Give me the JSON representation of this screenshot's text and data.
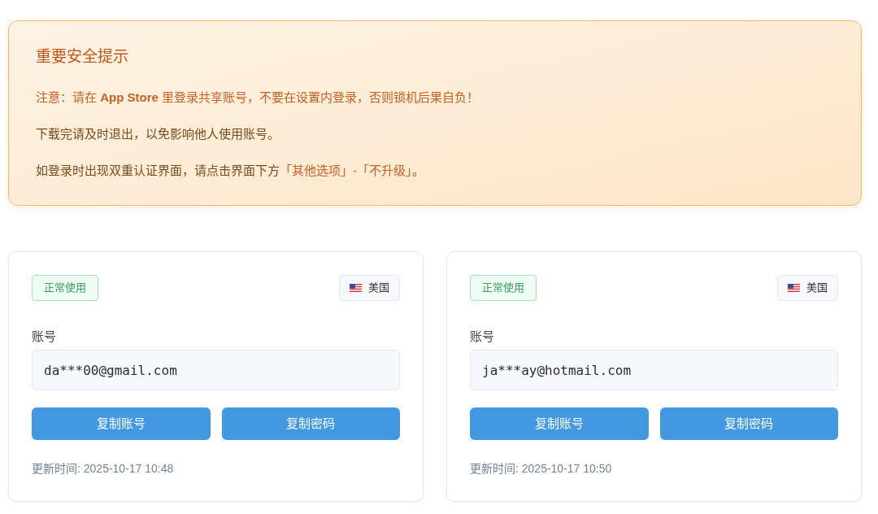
{
  "notice": {
    "title": "重要安全提示",
    "lines": [
      {
        "segments": [
          {
            "text": "注意：请在 **App Store** 里登录共享账号，不要在设置内登录，否则锁机后果自负！",
            "highlight": true
          }
        ]
      },
      {
        "segments": [
          {
            "text": "下载完请及时退出，以免影响他人使用账号。",
            "highlight": false
          }
        ]
      },
      {
        "segments": [
          {
            "text": "如登录时出现双重认证界面，请点击界面下方",
            "highlight": false
          },
          {
            "text": "「其他选项」-「不升级」",
            "highlight": true
          },
          {
            "text": "。",
            "highlight": false
          }
        ]
      }
    ]
  },
  "cards": [
    {
      "status": {
        "label": "正常使用",
        "kind": "normal"
      },
      "country": "美国",
      "field_label": "账号",
      "account": "da***00@gmail.com",
      "buttons": [
        "复制账号",
        "复制密码"
      ],
      "updated": "更新时间: 2025-10-17 10:48"
    },
    {
      "status": {
        "label": "正常使用",
        "kind": "normal"
      },
      "country": "美国",
      "field_label": "账号",
      "account": "ja***ay@hotmail.com",
      "buttons": [
        "复制账号",
        "复制密码"
      ],
      "updated": "更新时间: 2025-10-17 10:50"
    }
  ]
}
